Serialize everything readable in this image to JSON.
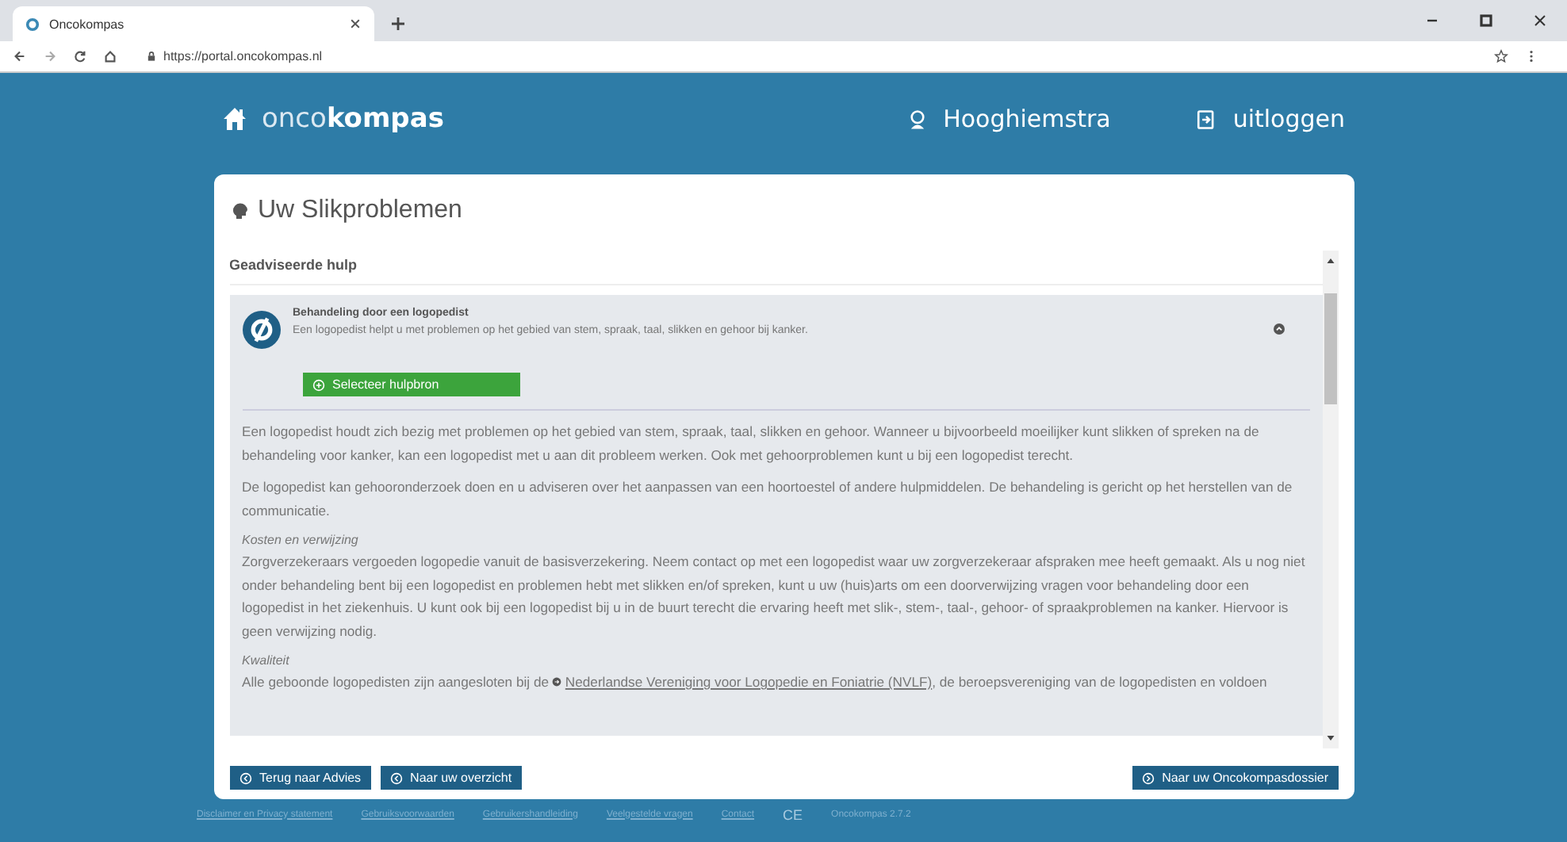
{
  "browser": {
    "tab_title": "Oncokompas",
    "url": "https://portal.oncokompas.nl"
  },
  "header": {
    "logo": "onco**kompas**",
    "user": "Hooghiemstra",
    "logout": "uitloggen"
  },
  "card": {
    "title": "Uw Slikproblemen",
    "section": "Geadviseerde hulp",
    "item": {
      "title": "Behandeling door een logopedist",
      "summary": "Een logopedist helpt u met problemen op het gebied van stem, spraak, taal, slikken en gehoor bij kanker.",
      "expanded": true,
      "select_button": "Selecteer hulpbron",
      "content": [
        {
          "kind": "paragraph",
          "text": "Een logopedist houdt zich bezig met problemen op het gebied van stem, spraak, taal, slikken en gehoor. Wanneer u bijvoorbeeld moeilijker kunt slikken of spreken na de behandeling voor kanker, kan een logopedist met u aan dit probleem werken. Ook met gehoorproblemen kunt u bij een logopedist terecht."
        },
        {
          "kind": "paragraph",
          "text": "De logopedist kan gehooronderzoek doen en u adviseren over het aanpassen van een hoortoestel of andere hulpmiddelen. De behandeling is gericht op het herstellen van de communicatie."
        },
        {
          "kind": "heading",
          "text": "Kosten en verwijzing"
        },
        {
          "kind": "paragraph",
          "text": "Zorgverzekeraars vergoeden logopedie vanuit de basisverzekering. Neem contact op met een logopedist waar uw zorgverzekeraar afspraken mee heeft gemaakt. Als u nog niet onder behandeling bent bij een logopedist en problemen hebt met slikken en/of spreken, kunt u uw (huis)arts om een doorverwijzing vragen voor behandeling door een logopedist in het ziekenhuis. U kunt ook bij een logopedist bij u in de buurt terecht die ervaring heeft met slik-, stem-, taal-, gehoor- of spraakproblemen na kanker. Hiervoor is geen verwijzing nodig."
        },
        {
          "kind": "heading",
          "text": "Kwaliteit"
        },
        {
          "kind": "linked",
          "before": "Alle geboonde logopedisten zijn aangesloten bij de",
          "link": "Nederlandse Vereniging voor Logopedie en Foniatrie (NVLF)",
          "after": ", de beroepsvereniging van de logopedisten en voldoen"
        }
      ]
    }
  },
  "left_buttons": [
    "Terug naar Advies",
    "Naar uw overzicht"
  ],
  "right_buttons": [
    "Naar uw Oncokompasdossier"
  ],
  "footer": {
    "links": [
      "Disclaimer en Privacy statement",
      "Gebruiksvoorwaarden",
      "Gebruikershandleiding",
      "Veelgestelde vragen",
      "Contact"
    ],
    "mark": "CE",
    "version": "Oncokompas 2.7.2"
  }
}
